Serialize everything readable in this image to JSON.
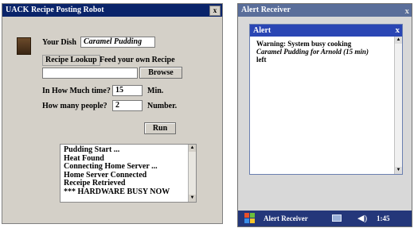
{
  "left_window": {
    "title": "UACK Recipe Posting Robot",
    "close_label": "x",
    "dish_label": "Your Dish",
    "dish_value": "Caramel Pudding",
    "tabs": {
      "recipe_lookup": "Recipe Lookup",
      "feed_own": "Feed your own Recipe"
    },
    "browse_label": "Browse",
    "path_value": "",
    "time_label": "In How Much time?",
    "time_value": "15",
    "time_unit": "Min.",
    "people_label": "How many people?",
    "people_value": "2",
    "people_unit": "Number.",
    "run_label": "Run",
    "log_lines": [
      "Pudding Start ...",
      "Heat Found",
      "Connecting Home Server ...",
      "Home Server Connected",
      "Receipe Retrieved",
      "*** HARDWARE BUSY NOW"
    ]
  },
  "right_window": {
    "title": "Alert Receiver",
    "close_label": "x",
    "alert": {
      "title": "Alert",
      "close_label": "x",
      "line1": "Warning: System busy cooking",
      "line2": "Caramel Pudding for Arnold (15 min)",
      "line3": "left"
    },
    "taskbar": {
      "item_label": "Alert Receiver",
      "clock": "1:45"
    }
  },
  "colors": {
    "left_title_bg": "#0a246a",
    "right_title_bg": "#5a6e9a",
    "alert_title_bg": "#2a46b4",
    "taskbar_bg": "#24377a"
  }
}
